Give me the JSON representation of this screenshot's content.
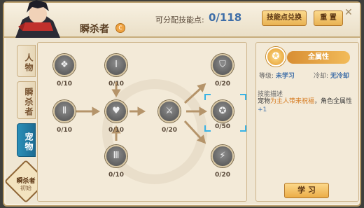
{
  "header": {
    "char_name": "瞬杀者",
    "points_label": "可分配技能点:",
    "points_value": "0/118",
    "exchange_label": "技能点兑换",
    "reset_label": "重 置"
  },
  "tabs": [
    {
      "label": "人物"
    },
    {
      "label": "瞬杀者"
    },
    {
      "label": "宠物"
    }
  ],
  "badge": {
    "title": "瞬杀者",
    "subtitle": "初始"
  },
  "nodes": [
    {
      "icon": "beast-icon",
      "level": "0/10"
    },
    {
      "icon": "tier1-icon",
      "level": "0/10"
    },
    {
      "icon": "tier2-icon",
      "level": "0/10"
    },
    {
      "icon": "heart-icon",
      "level": "0/10"
    },
    {
      "icon": "tier3-icon",
      "level": "0/10"
    },
    {
      "icon": "sword-icon",
      "level": "0/20"
    },
    {
      "icon": "shield-icon",
      "level": "0/20"
    },
    {
      "icon": "blessing-icon",
      "level": "0/50"
    },
    {
      "icon": "lightning-icon",
      "level": "0/20"
    }
  ],
  "detail": {
    "name": "全属性",
    "level_label": "等级:",
    "level_value": "未学习",
    "cd_label": "冷却:",
    "cd_value": "无冷却",
    "desc_title": "技能描述",
    "desc_part1": "宠物",
    "desc_part2": "为主人带来祝福",
    "desc_part3": "，角色全属性",
    "desc_part4": "+1",
    "learn_label": "学 习"
  },
  "colors": {
    "accent_blue": "#3e6ea8",
    "gold": "#e9b253",
    "tab_active": "#1d6c93",
    "selection": "#38b3e6"
  }
}
